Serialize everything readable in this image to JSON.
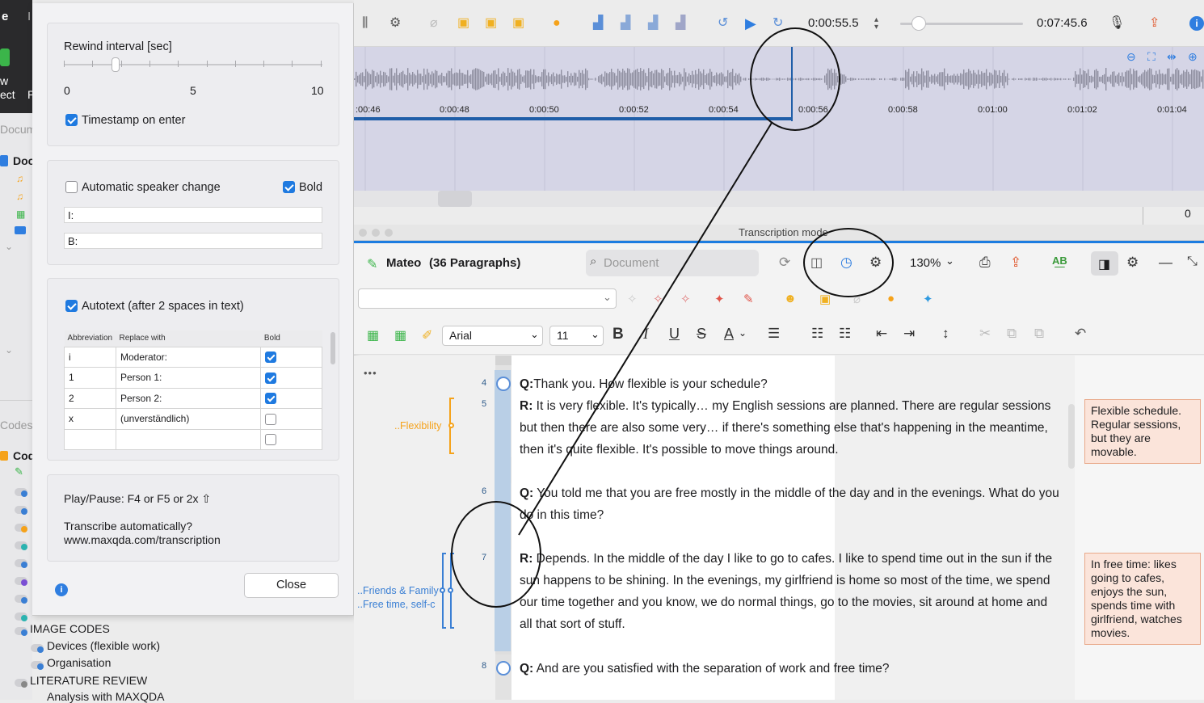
{
  "colors": {
    "accent": "#1c7ce0",
    "waveform_bg": "#d5d5e6",
    "memo_bg": "#fbe4da",
    "code_orange": "#f5a21a",
    "code_blue": "#3a7fd4"
  },
  "sidebar": {
    "top_tab_fragments": [
      "e",
      "I"
    ],
    "new_project_fragments": [
      "w",
      "ect",
      "P"
    ],
    "documents_header": "Docum",
    "documents_item": "Doc",
    "codes_header": "Codes",
    "codes_item": "Cod",
    "image_codes": "IMAGE CODES",
    "image_code_items": [
      "Devices (flexible work)",
      "Organisation"
    ],
    "literature_review": "LITERATURE REVIEW",
    "literature_item": "Analysis with MAXQDA"
  },
  "dialog": {
    "rewind_label": "Rewind interval [sec]",
    "rewind_value": 2,
    "rewind_ticks": [
      "0",
      "5",
      "10"
    ],
    "timestamp_on_enter": "Timestamp on enter",
    "timestamp_checked": true,
    "auto_speaker_change": "Automatic speaker change",
    "auto_speaker_checked": false,
    "bold_label": "Bold",
    "bold_checked": true,
    "speaker1_value": "I:",
    "speaker2_value": "B:",
    "autotext_label": "Autotext (after 2 spaces in text)",
    "autotext_checked": true,
    "table_headers": [
      "Abbreviation",
      "Replace with",
      "Bold"
    ],
    "table_rows": [
      {
        "abbr": "i",
        "replace": "Moderator:",
        "bold": true
      },
      {
        "abbr": "1",
        "replace": "Person 1:",
        "bold": true
      },
      {
        "abbr": "2",
        "replace": "Person 2:",
        "bold": true
      },
      {
        "abbr": "x",
        "replace": "(unverständlich)",
        "bold": false
      },
      {
        "abbr": "",
        "replace": "",
        "bold": false
      }
    ],
    "play_pause": "Play/Pause: F4 or F5 or 2x ⇧",
    "transcribe_q": "Transcribe automatically?",
    "transcribe_url": "www.maxqda.com/transcription",
    "close_label": "Close"
  },
  "player": {
    "current_time": "0:00:55.5",
    "total_time": "0:07:45.6",
    "timeline_labels": [
      ":00:46",
      "0:00:48",
      "0:00:50",
      "0:00:52",
      "0:00:54",
      "0:00:56",
      "0:00:58",
      "0:01:00",
      "0:01:02",
      "0:01:04"
    ],
    "counter": "0"
  },
  "transcription": {
    "window_title": "Transcription mode",
    "doc_name": "Mateo",
    "paragraph_count": "(36 Paragraphs)",
    "search_placeholder": "Document",
    "zoom": "130%",
    "font_name": "Arial",
    "font_size": "11",
    "more": "•••",
    "paragraphs": [
      {
        "num": "4",
        "speaker": "Q:",
        "text": "Thank you. How flexible is your schedule?"
      },
      {
        "num": "5",
        "speaker": "R:",
        "text": " It is very flexible. It's typically… my English sessions are planned. There are regular sessions but then there are also some very… if there's something else that's happening in the meantime, then it's quite flexible. It's possible to move things around."
      },
      {
        "num": "6",
        "speaker": "Q:",
        "text": " You told me that you are free mostly in the middle of the day and in the evenings. What do you do in this time?"
      },
      {
        "num": "7",
        "speaker": "R:",
        "text": " Depends. In the middle of the day I like to go to cafes. I like to spend time out in the sun if the sun happens to be shining. In the evenings, my girlfriend is home so most of the time, we spend our time together and you know, we do normal things, go to the movies, sit around at home and all that sort of stuff."
      },
      {
        "num": "8",
        "speaker": "Q:",
        "text": " And are you satisfied with the separation of work and free time?"
      }
    ],
    "codes": {
      "flexibility": "..Flexibility",
      "friends": "..Friends & Family",
      "freetime": "..Free time, self-c"
    },
    "memos": [
      "Flexible schedule. Regular sessions, but they are movable.",
      "In free time: likes going to cafes, enjoys the sun, spends time with girlfriend, watches movies."
    ]
  }
}
